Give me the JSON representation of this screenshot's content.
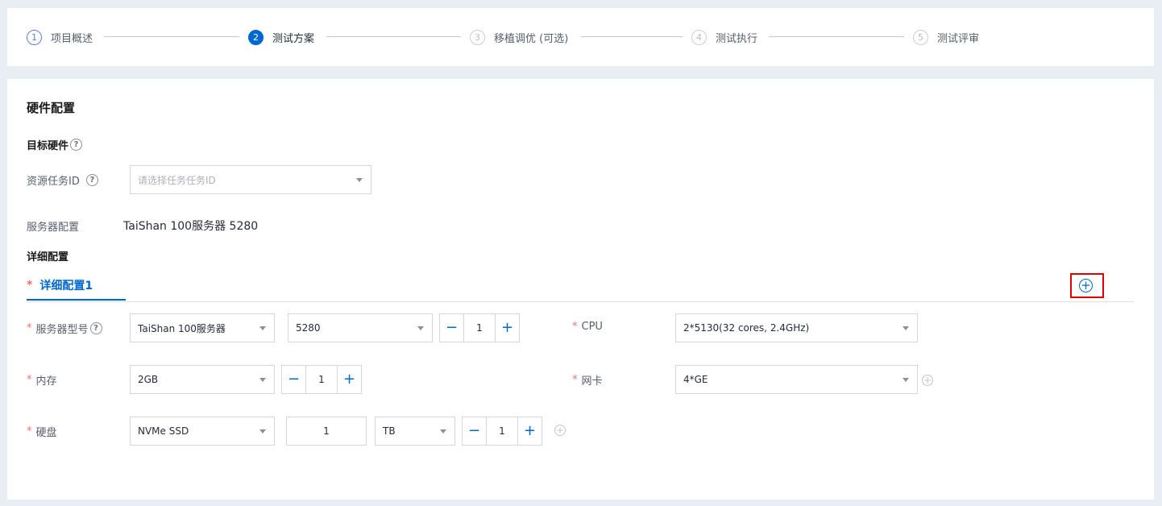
{
  "steps": [
    {
      "num": "1",
      "label": "项目概述",
      "state": "done"
    },
    {
      "num": "2",
      "label": "测试方案",
      "state": "active"
    },
    {
      "num": "3",
      "label": "移植调优 (可选)",
      "state": "pending"
    },
    {
      "num": "4",
      "label": "测试执行",
      "state": "pending"
    },
    {
      "num": "5",
      "label": "测试评审",
      "state": "pending"
    }
  ],
  "hardware": {
    "title": "硬件配置",
    "target_title": "目标硬件",
    "help_glyph": "?",
    "resource_label": "资源任务ID",
    "resource_placeholder": "请选择任务任务ID",
    "server_config_label": "服务器配置",
    "server_config_value": "TaiShan 100服务器 5280",
    "detail_title": "详细配置"
  },
  "detail": {
    "tab_required": "*",
    "tab_label": "详细配置1",
    "add_glyph": "+",
    "server_model": {
      "label": "服务器型号",
      "series": "TaiShan 100服务器",
      "model": "5280",
      "qty": "1"
    },
    "cpu": {
      "label": "CPU",
      "value": "2*5130(32 cores, 2.4GHz)"
    },
    "memory": {
      "label": "内存",
      "value": "2GB",
      "qty": "1"
    },
    "nic": {
      "label": "网卡",
      "value": "4*GE"
    },
    "disk": {
      "label": "硬盘",
      "type": "NVMe SSD",
      "size": "1",
      "unit": "TB",
      "qty": "1"
    },
    "minus_glyph": "−",
    "plus_glyph": "+"
  },
  "colors": {
    "accent": "#0067d1",
    "required": "#f66f6a",
    "highlight": "#e00000"
  }
}
